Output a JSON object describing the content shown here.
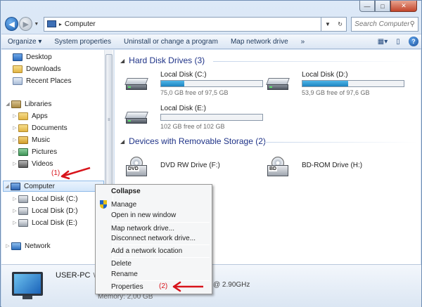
{
  "window": {
    "caption": {
      "minimize": "—",
      "maximize": "□",
      "close": "✕"
    }
  },
  "address_bar": {
    "back": "◀",
    "forward": "▶",
    "path_separator": "▸",
    "path": "Computer",
    "search_placeholder": "Search Computer"
  },
  "toolbar": {
    "organize": "Organize ▾",
    "items": [
      "System properties",
      "Uninstall or change a program",
      "Map network drive",
      "»"
    ]
  },
  "nav": {
    "favorites": [
      {
        "label": "Desktop",
        "icon": "desktop-icon"
      },
      {
        "label": "Downloads",
        "icon": "folder-icon"
      },
      {
        "label": "Recent Places",
        "icon": "recent-places-icon"
      }
    ],
    "libraries": {
      "label": "Libraries",
      "items": [
        {
          "label": "Apps",
          "icon": "folder-icon"
        },
        {
          "label": "Documents",
          "icon": "documents-icon"
        },
        {
          "label": "Music",
          "icon": "music-icon"
        },
        {
          "label": "Pictures",
          "icon": "pictures-icon"
        },
        {
          "label": "Videos",
          "icon": "videos-icon"
        }
      ]
    },
    "computer": {
      "label": "Computer",
      "items": [
        {
          "label": "Local Disk (C:)",
          "icon": "local-disk-icon"
        },
        {
          "label": "Local Disk (D:)",
          "icon": "local-disk-icon"
        },
        {
          "label": "Local Disk (E:)",
          "icon": "local-disk-icon"
        }
      ]
    },
    "network": {
      "label": "Network"
    }
  },
  "content": {
    "hard_disks": {
      "title": "Hard Disk Drives (3)",
      "drives": [
        {
          "name": "Local Disk (C:)",
          "free_text": "75,0 GB free of 97,5 GB",
          "used_fraction": 0.23
        },
        {
          "name": "Local Disk (D:)",
          "free_text": "53,9 GB free of 97,6 GB",
          "used_fraction": 0.45
        },
        {
          "name": "Local Disk (E:)",
          "free_text": "102 GB free of 102 GB",
          "used_fraction": 0.0
        }
      ]
    },
    "removable": {
      "title": "Devices with Removable Storage (2)",
      "drives": [
        {
          "name": "DVD RW Drive (F:)",
          "badge": "DVD"
        },
        {
          "name": "BD-ROM Drive (H:)",
          "badge": "BD"
        }
      ]
    }
  },
  "context_menu": {
    "collapse": "Collapse",
    "manage": "Manage",
    "open_new_window": "Open in new window",
    "map_drive": "Map network drive...",
    "disconnect_drive": "Disconnect network drive...",
    "add_location": "Add a network location",
    "delete": "Delete",
    "rename": "Rename",
    "properties": "Properties"
  },
  "details": {
    "pc_name": "USER-PC",
    "workgroup_fragment": "W",
    "cpu_fragment": "@ 2.90GHz",
    "memory": "Memory: 2,00 GB"
  },
  "annotations": {
    "label_1": "(1)",
    "label_2": "(2)",
    "color": "#d8141b"
  }
}
